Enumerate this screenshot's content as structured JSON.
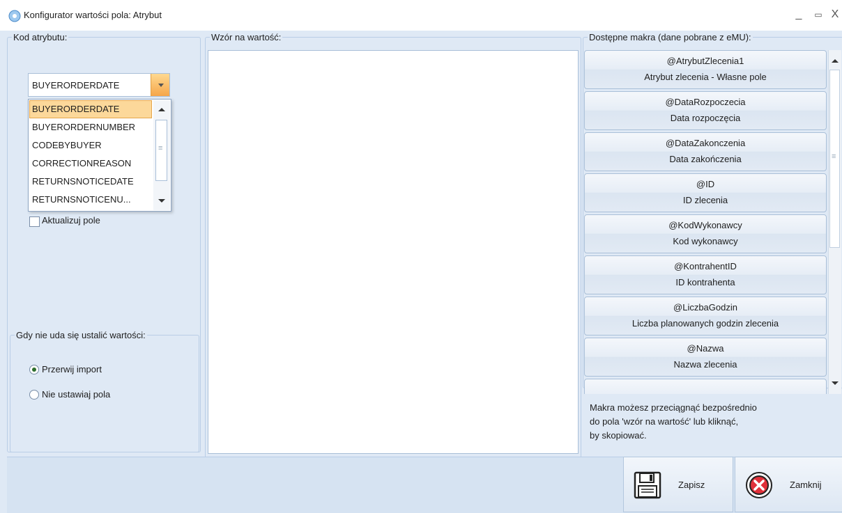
{
  "window": {
    "title": "Konfigurator wartości pola: Atrybut",
    "min_symbol": "_",
    "max_symbol": "▭",
    "close_symbol": "X"
  },
  "left": {
    "group_label": "Kod atrybutu:",
    "combo_value": "BUYERORDERDATE",
    "dropdown_options": [
      "BUYERORDERDATE",
      "BUYERORDERNUMBER",
      "CODEBYBUYER",
      "CORRECTIONREASON",
      "RETURNSNOTICEDATE",
      "RETURNSNOTICENU..."
    ],
    "selected_option": "BUYERORDERDATE",
    "checkbox_label": "Aktualizuj pole",
    "checkbox_checked": false,
    "fallback_group_label": "Gdy nie uda się ustalić wartości:",
    "radio_options": [
      {
        "label": "Przerwij import",
        "checked": true
      },
      {
        "label": "Nie ustawiaj pola",
        "checked": false
      }
    ]
  },
  "middle": {
    "group_label": "Wzór na wartość:",
    "textarea_value": ""
  },
  "right": {
    "group_label": "Dostępne makra (dane pobrane z eMU):",
    "macros": [
      {
        "code": "@AtrybutZlecenia1",
        "desc": "Atrybut zlecenia - Własne pole"
      },
      {
        "code": "@DataRozpoczecia",
        "desc": "Data rozpoczęcia"
      },
      {
        "code": "@DataZakonczenia",
        "desc": "Data zakończenia"
      },
      {
        "code": "@ID",
        "desc": "ID zlecenia"
      },
      {
        "code": "@KodWykonawcy",
        "desc": "Kod wykonawcy"
      },
      {
        "code": "@KontrahentID",
        "desc": "ID kontrahenta"
      },
      {
        "code": "@LiczbaGodzin",
        "desc": "Liczba planowanych godzin zlecenia"
      },
      {
        "code": "@Nazwa",
        "desc": "Nazwa zlecenia"
      }
    ],
    "hint_lines": [
      "Makra możesz przeciągnąć bezpośrednio",
      "do pola 'wzór na wartość' lub kliknąć,",
      "by skopiować."
    ]
  },
  "buttons": {
    "save_label": "Zapisz",
    "close_label": "Zamknij"
  },
  "colors": {
    "window_bg": "#dfe9f5",
    "selected_item": "#fcd89a",
    "combo_arrow": "#f5a64a",
    "close_icon_red": "#e0303a"
  },
  "icons": {
    "app": "gear-flower-icon",
    "save": "floppy-disk-icon",
    "close": "close-circle-icon"
  }
}
